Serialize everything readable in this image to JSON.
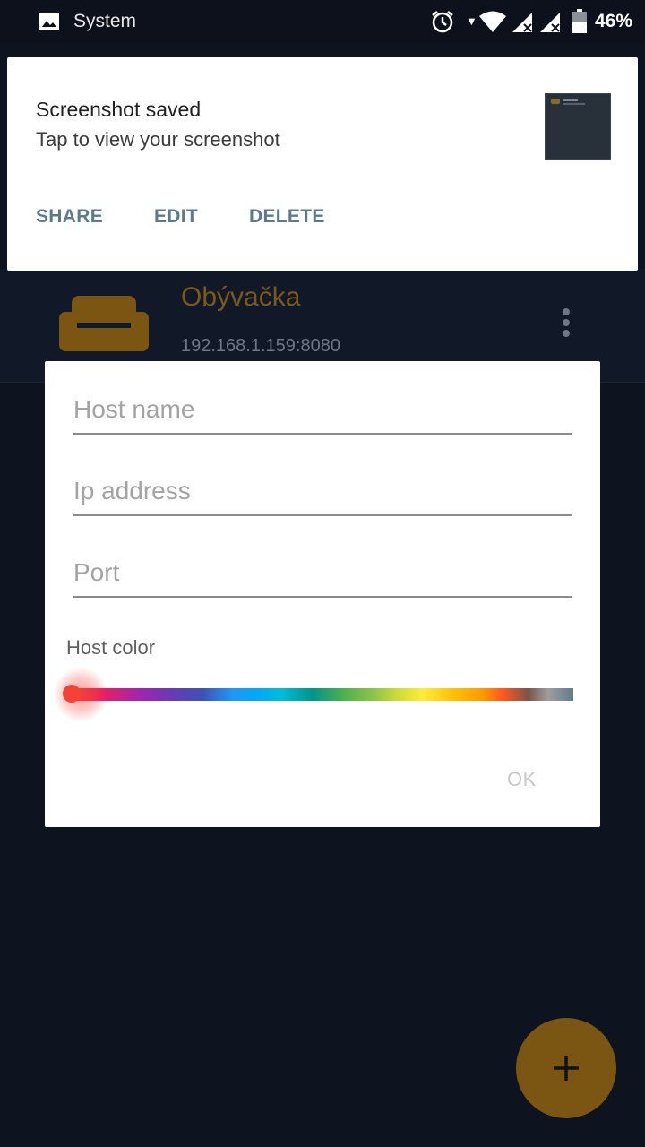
{
  "status_bar": {
    "app_icon": "image-icon",
    "app_name": "System",
    "icons": [
      "alarm-icon",
      "download-arrow-icon",
      "wifi-icon",
      "signal-icon",
      "signal-icon",
      "battery-icon"
    ],
    "battery_percent": "46%"
  },
  "notification": {
    "title": "Screenshot saved",
    "text": "Tap to view your screenshot",
    "thumbnail": "screenshot-thumbnail",
    "actions": [
      "SHARE",
      "EDIT",
      "DELETE"
    ],
    "action_color": "#5b7a8c"
  },
  "host_item": {
    "icon": "sofa-icon",
    "name": "Obývačka",
    "address": "192.168.1.159:8080",
    "accent_color": "#7a5a1c",
    "menu_icon": "more-vert-icon"
  },
  "dialog": {
    "host_name_placeholder": "Host name",
    "ip_placeholder": "Ip address",
    "port_placeholder": "Port",
    "color_label": "Host color",
    "selected_color": "#f44336",
    "slider_position": 0,
    "ok_label": "OK"
  },
  "fab": {
    "icon": "plus-icon",
    "color": "#7a5612"
  }
}
